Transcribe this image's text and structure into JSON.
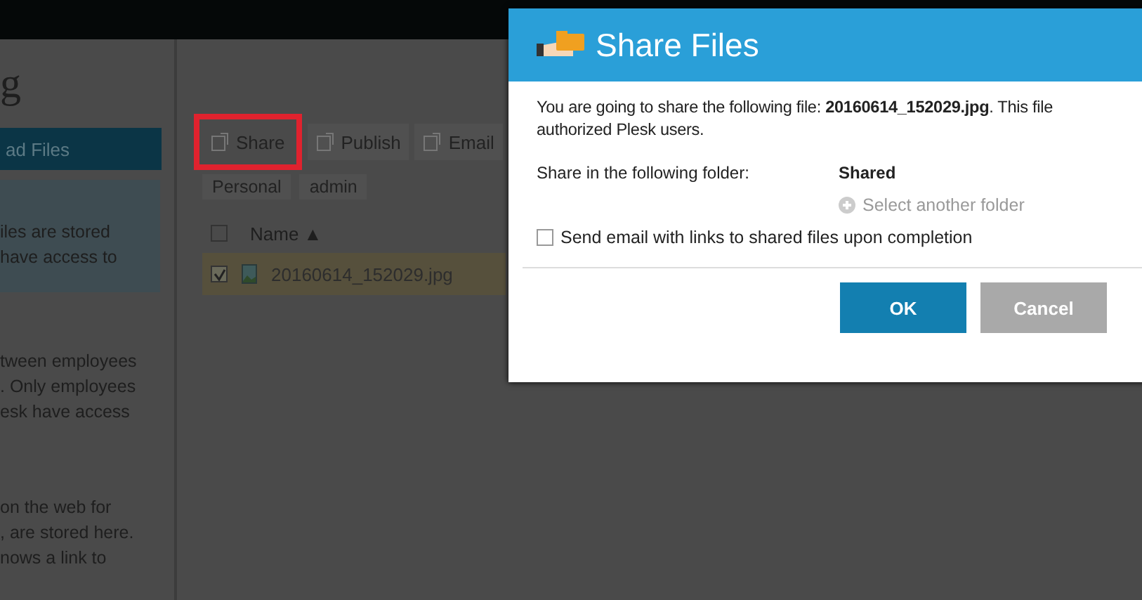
{
  "sidebar": {
    "title": "g",
    "upload_button": "ad Files",
    "info_lines": [
      "iles are stored",
      "have access to"
    ],
    "paragraphs": [
      [
        "tween employees",
        ". Only employees",
        "esk have access"
      ],
      [
        "on the web for",
        ", are stored here.",
        "nows a link to"
      ]
    ]
  },
  "toolbar": {
    "buttons": [
      {
        "label": "Share",
        "highlighted": true
      },
      {
        "label": "Publish",
        "highlighted": false
      },
      {
        "label": "Email",
        "highlighted": false
      }
    ]
  },
  "breadcrumb": [
    "Personal",
    "admin"
  ],
  "table": {
    "header": {
      "checked": false,
      "name": "Name ▲"
    },
    "rows": [
      {
        "name": "20160614_152029.jpg",
        "checked": true,
        "selected": true
      }
    ]
  },
  "dialog": {
    "title": "Share Files",
    "message_lines": [
      "You are going to share the following file: **20160614_152029.jpg**. This file",
      "authorized Plesk users."
    ],
    "folder_label": "Share in the following folder:",
    "folder_value": "Shared",
    "select_link": "Select another folder",
    "email_option": {
      "label": "Send email with links to shared files upon completion",
      "checked": false
    },
    "buttons": [
      {
        "label": "OK",
        "kind": "primary"
      },
      {
        "label": "Cancel",
        "kind": "secondary"
      }
    ]
  }
}
